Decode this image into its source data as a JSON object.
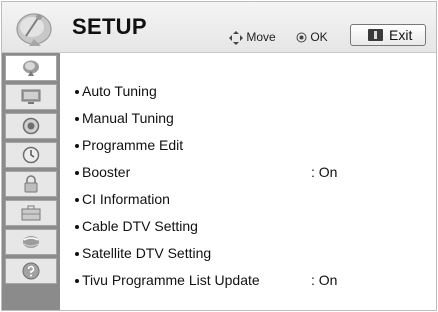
{
  "header": {
    "title": "SETUP",
    "icon": "satellite-dish-icon",
    "hints": {
      "move_label": "Move",
      "ok_label": "OK"
    },
    "exit_label": "Exit"
  },
  "sidebar": {
    "items": [
      {
        "icon": "satellite-dish-icon",
        "active": true
      },
      {
        "icon": "monitor-icon",
        "active": false
      },
      {
        "icon": "speaker-icon",
        "active": false
      },
      {
        "icon": "clock-icon",
        "active": false
      },
      {
        "icon": "lock-icon",
        "active": false
      },
      {
        "icon": "briefcase-icon",
        "active": false
      },
      {
        "icon": "globe-icon",
        "active": false
      },
      {
        "icon": "help-icon",
        "active": false
      }
    ]
  },
  "menu": {
    "items": [
      {
        "label": "Auto Tuning",
        "value": ""
      },
      {
        "label": "Manual Tuning",
        "value": ""
      },
      {
        "label": "Programme Edit",
        "value": ""
      },
      {
        "label": "Booster",
        "value": ": On"
      },
      {
        "label": "CI Information",
        "value": ""
      },
      {
        "label": "Cable DTV Setting",
        "value": ""
      },
      {
        "label": "Satellite DTV Setting",
        "value": ""
      },
      {
        "label": "Tivu Programme List Update",
        "value": ": On"
      }
    ]
  },
  "colors": {
    "sidebar_background": "#8b8b8b",
    "header_background": "#e6e6e6",
    "active_tab_background": "#ffffff"
  }
}
